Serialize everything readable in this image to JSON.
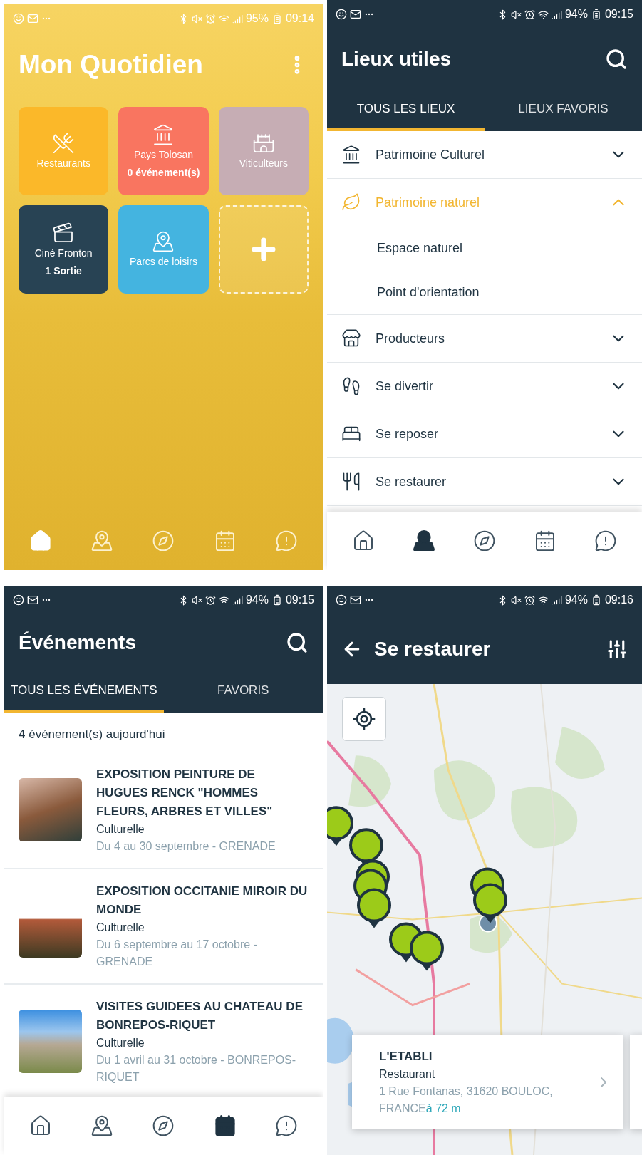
{
  "screens": [
    {
      "kind": "home",
      "status": {
        "battery": "95%",
        "time": "09:14"
      },
      "title": "Mon Quotidien",
      "tiles": [
        {
          "kind": "category",
          "label": "Restaurants",
          "color": "#fbb829"
        },
        {
          "kind": "category",
          "label": "Pays Tolosan",
          "sub": "0 événement(s)",
          "color": "#f97560"
        },
        {
          "kind": "category",
          "label": "Viticulteurs",
          "color": "#c6adb4"
        },
        {
          "kind": "category",
          "label": "Ciné Fronton",
          "sub": "1 Sortie",
          "color": "#284354"
        },
        {
          "kind": "category",
          "label": "Parcs de loisirs",
          "color": "#44b4e0"
        },
        {
          "kind": "add"
        }
      ],
      "nav": [
        {
          "selected": true
        },
        {
          "selected": false
        },
        {
          "selected": false
        },
        {
          "selected": false
        },
        {
          "selected": false
        }
      ]
    },
    {
      "kind": "places",
      "status": {
        "battery": "94%",
        "time": "09:15"
      },
      "title": "Lieux utiles",
      "tabs": [
        {
          "label": "TOUS LES LIEUX",
          "selected": true
        },
        {
          "label": "LIEUX FAVORIS",
          "selected": false
        }
      ],
      "categories": [
        {
          "label": "Patrimoine Culturel",
          "expanded": false
        },
        {
          "label": "Patrimoine naturel",
          "expanded": true,
          "children": [
            {
              "label": "Espace naturel"
            },
            {
              "label": "Point d'orientation"
            }
          ]
        },
        {
          "label": "Producteurs",
          "expanded": false
        },
        {
          "label": "Se divertir",
          "expanded": false
        },
        {
          "label": "Se reposer",
          "expanded": false
        },
        {
          "label": "Se restaurer",
          "expanded": false
        }
      ],
      "nav": [
        {
          "selected": false
        },
        {
          "selected": true
        },
        {
          "selected": false
        },
        {
          "selected": false
        },
        {
          "selected": false
        }
      ]
    },
    {
      "kind": "events",
      "status": {
        "battery": "94%",
        "time": "09:15"
      },
      "title": "Événements",
      "tabs": [
        {
          "label": "TOUS LES ÉVÉNEMENTS",
          "selected": true
        },
        {
          "label": "FAVORIS",
          "selected": false
        }
      ],
      "count": "4 événement(s) aujourd'hui",
      "events": [
        {
          "title": "EXPOSITION PEINTURE DE HUGUES RENCK \"HOMMES FLEURS, ARBRES ET VILLES\"",
          "type": "Culturelle",
          "dates": "Du 4 au 30 septembre - GRENADE"
        },
        {
          "title": "EXPOSITION OCCITANIE MIROIR DU MONDE",
          "type": "Culturelle",
          "dates": "Du 6 septembre au 17 octobre - GRENADE"
        },
        {
          "title": "VISITES GUIDEES AU CHATEAU DE BONREPOS-RIQUET",
          "type": "Culturelle",
          "dates": "Du 1 avril au 31 octobre - BONREPOS-RIQUET"
        }
      ],
      "nav": [
        {
          "selected": false
        },
        {
          "selected": false
        },
        {
          "selected": false
        },
        {
          "selected": true
        },
        {
          "selected": false
        }
      ]
    },
    {
      "kind": "map",
      "status": {
        "battery": "94%",
        "time": "09:16"
      },
      "title": "Se restaurer",
      "card": {
        "name": "L'ETABLI",
        "type": "Restaurant",
        "address": "1 Rue Fontanas, 31620 BOULOC, FRANCE",
        "distance": "à 72 m"
      }
    }
  ]
}
